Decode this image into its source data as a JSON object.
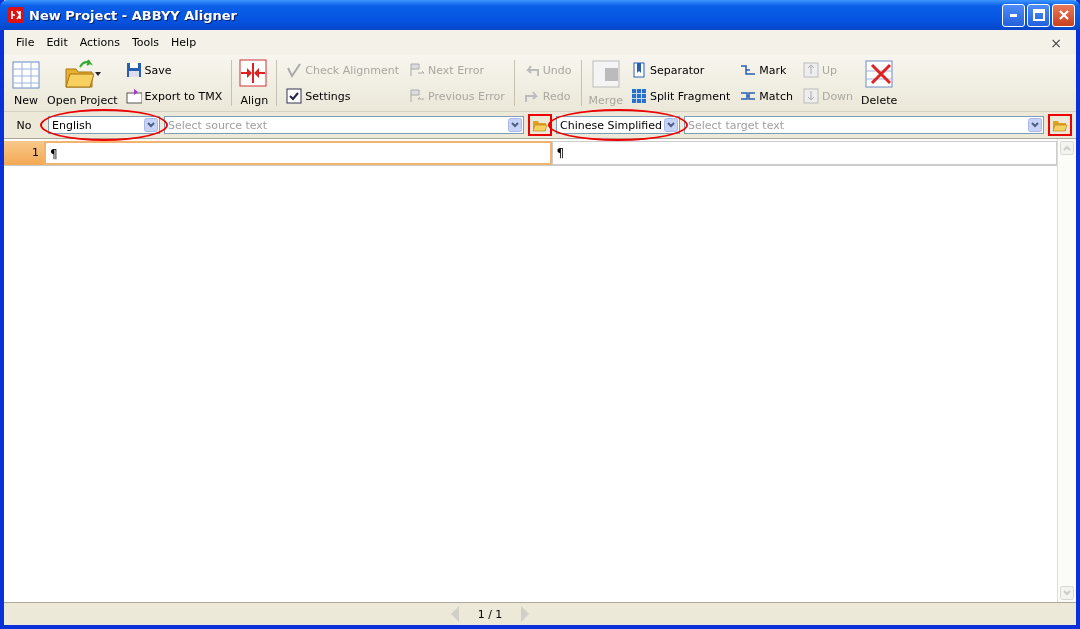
{
  "window": {
    "title": "New Project - ABBYY Aligner"
  },
  "menu": {
    "items": [
      "File",
      "Edit",
      "Actions",
      "Tools",
      "Help"
    ],
    "close": "×"
  },
  "toolbar": {
    "groups": [
      [
        {
          "kind": "large",
          "label": "New",
          "disabled": false
        },
        {
          "kind": "large",
          "label": "Open Project",
          "disabled": false,
          "caret": true
        },
        {
          "kind": "pair",
          "items": [
            {
              "label": "Save",
              "disabled": false
            },
            {
              "label": "Export to TMX",
              "disabled": false
            }
          ]
        }
      ],
      [
        {
          "kind": "large",
          "label": "Align",
          "disabled": false
        }
      ],
      [
        {
          "kind": "pair",
          "items": [
            {
              "label": "Check Alignment",
              "disabled": true
            },
            {
              "label": "Settings",
              "disabled": false
            }
          ]
        },
        {
          "kind": "pair",
          "items": [
            {
              "label": "Next Error",
              "disabled": true
            },
            {
              "label": "Previous Error",
              "disabled": true
            }
          ]
        }
      ],
      [
        {
          "kind": "pair",
          "items": [
            {
              "label": "Undo",
              "disabled": true
            },
            {
              "label": "Redo",
              "disabled": true
            }
          ]
        }
      ],
      [
        {
          "kind": "large",
          "label": "Merge",
          "disabled": true
        },
        {
          "kind": "pair",
          "items": [
            {
              "label": "Separator",
              "disabled": false
            },
            {
              "label": "Split Fragment",
              "disabled": false
            }
          ]
        },
        {
          "kind": "pair",
          "items": [
            {
              "label": "Mark",
              "disabled": false
            },
            {
              "label": "Match",
              "disabled": false
            }
          ]
        },
        {
          "kind": "pair",
          "items": [
            {
              "label": "Up",
              "disabled": true
            },
            {
              "label": "Down",
              "disabled": true
            }
          ]
        },
        {
          "kind": "large",
          "label": "Delete",
          "disabled": false
        }
      ]
    ]
  },
  "language_bar": {
    "no_label": "No",
    "source": {
      "language": "English",
      "text_placeholder": "Select source text",
      "language_highlighted": true,
      "folder_highlighted": true
    },
    "target": {
      "language": "Chinese Simplified",
      "text_placeholder": "Select target text",
      "language_highlighted": true,
      "folder_highlighted": true
    }
  },
  "rows": [
    {
      "number": "1",
      "source": "¶",
      "target": "¶",
      "selected": true
    }
  ],
  "status_bar": {
    "page": "1 / 1"
  }
}
